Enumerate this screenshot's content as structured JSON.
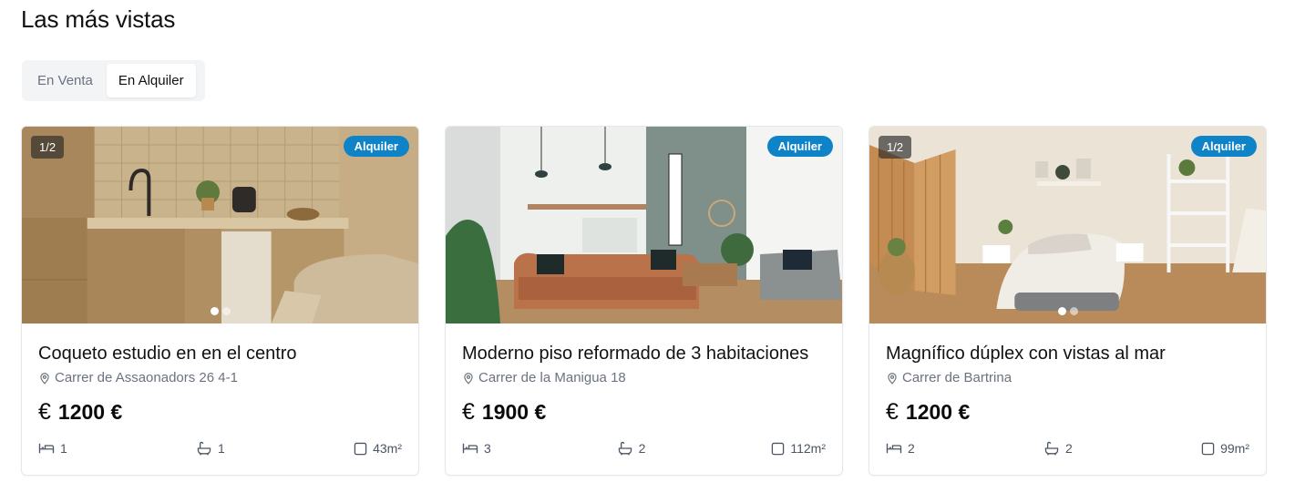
{
  "section": {
    "title": "Las más vistas"
  },
  "tabs": [
    {
      "label": "En Venta",
      "active": false
    },
    {
      "label": "En Alquiler",
      "active": true
    }
  ],
  "listings": [
    {
      "counter": "1/2",
      "badge": "Alquiler",
      "title": "Coqueto estudio en en el centro",
      "address": "Carrer de Assaonadors 26 4-1",
      "currency_icon": "€",
      "price": "1200 €",
      "bedrooms": "1",
      "bathrooms": "1",
      "area": "43m²",
      "image_icon": "kitchen-photo",
      "has_dots": true
    },
    {
      "counter": "",
      "badge": "Alquiler",
      "title": "Moderno piso reformado de 3 habitaciones",
      "address": "Carrer de la Manigua 18",
      "currency_icon": "€",
      "price": "1900 €",
      "bedrooms": "3",
      "bathrooms": "2",
      "area": "112m²",
      "image_icon": "living-room-photo",
      "has_dots": false
    },
    {
      "counter": "1/2",
      "badge": "Alquiler",
      "title": "Magnífico dúplex con vistas al mar",
      "address": "Carrer de Bartrina",
      "currency_icon": "€",
      "price": "1200 €",
      "bedrooms": "2",
      "bathrooms": "2",
      "area": "99m²",
      "image_icon": "bedroom-photo",
      "has_dots": true
    }
  ],
  "colors": {
    "badge": "#0f83c8",
    "tab_bg": "#f3f4f6",
    "muted_text": "#6b7280"
  }
}
